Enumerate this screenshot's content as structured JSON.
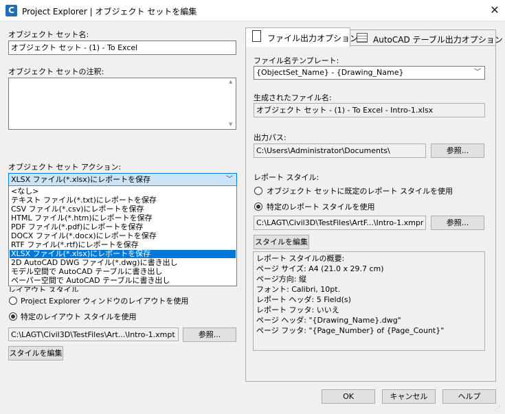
{
  "window": {
    "app_icon_letter": "C",
    "title": "Project Explorer | オブジェクト セットを編集"
  },
  "left": {
    "name_label": "オブジェクト セット名:",
    "name_value": "オブジェクト セット - (1) - To Excel",
    "note_label": "オブジェクト セットの注釈:",
    "note_value": "",
    "action_label": "オブジェクト セット アクション:",
    "action_selected": "XLSX ファイル(*.xlsx)にレポートを保存",
    "action_options": [
      "<なし>",
      "テキスト ファイル(*.txt)にレポートを保存",
      "CSV ファイル(*.csv)にレポートを保存",
      "HTML ファイル(*.htm)にレポートを保存",
      "PDF ファイル(*.pdf)にレポートを保存",
      "DOCX ファイル(*.docx)にレポートを保存",
      "RTF ファイル(*.rtf)にレポートを保存",
      "XLSX ファイル(*.xlsx)にレポートを保存",
      "2D AutoCAD DWG ファイル(*.dwg)に書き出し",
      "モデル空間で AutoCAD テーブルに書き出し",
      "ペーパー空間で AutoCAD テーブルに書き出し"
    ],
    "selected_index": 7,
    "layout_style_label": "レイアウト スタイル",
    "radio_window_layout": "Project Explorer ウィンドウのレイアウトを使用",
    "radio_specific_layout": "特定のレイアウト スタイルを使用",
    "layout_path": "C:\\LAGT\\Civil3D\\TestFiles\\Art...\\Intro-1.xmpt",
    "browse_label": "参照...",
    "edit_style_label": "スタイルを編集"
  },
  "tabs": [
    {
      "label": "ファイル出力オプション",
      "icon": "document-icon",
      "active": true
    },
    {
      "label": "AutoCAD テーブル出力オプション",
      "icon": "table-icon",
      "active": false
    }
  ],
  "right": {
    "template_label": "ファイル名テンプレート:",
    "template_value": "{ObjectSet_Name} - {Drawing_Name}",
    "generated_label": "生成されたファイル名:",
    "generated_value": "オブジェクト セット - (1) - To Excel - Intro-1.xlsx",
    "output_path_label": "出力パス:",
    "output_path_value": "C:\\Users\\Administrator\\Documents\\",
    "browse_label": "参照...",
    "report_style_label": "レポート スタイル:",
    "radio_default_style": "オブジェクト セットに既定のレポート スタイルを使用",
    "radio_specific_style": "特定のレポート スタイルを使用",
    "style_path": "C:\\LAGT\\Civil3D\\TestFiles\\ArtF...\\Intro-1.xmpr",
    "style_browse_label": "参照...",
    "edit_style_label": "スタイルを編集",
    "summary_lines": [
      "レポート スタイルの概要:",
      "  ページ サイズ: A4 (21.0 x 29.7 cm)",
      "  ページ方向: 縦",
      "  フォント: Calibri, 10pt.",
      "  レポート ヘッダ: 5 Field(s)",
      "  レポート フッタ: いいえ",
      "  ページ ヘッダ: \"{Drawing_Name}.dwg\"",
      "  ページ フッタ: \"{Page_Number} of {Page_Count}\""
    ]
  },
  "footer": {
    "ok": "OK",
    "cancel": "キャンセル",
    "help": "ヘルプ"
  }
}
